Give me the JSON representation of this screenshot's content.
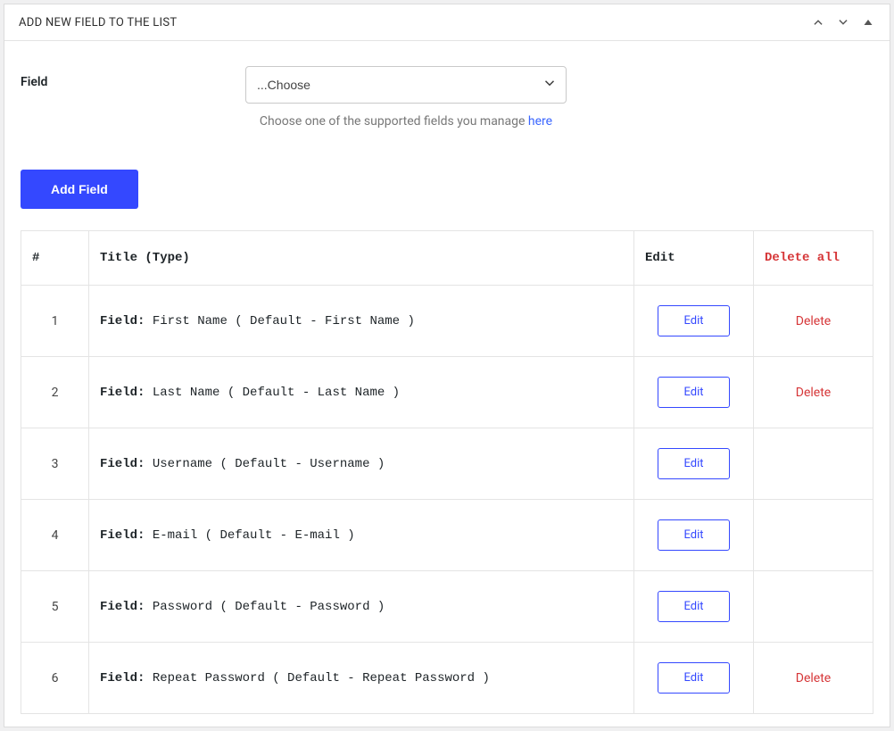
{
  "panel": {
    "title": "ADD NEW FIELD TO THE LIST"
  },
  "form": {
    "field_label": "Field",
    "select_placeholder": "...Choose",
    "help_prefix": "Choose one of the supported fields you manage ",
    "help_link": "here",
    "add_button": "Add Field"
  },
  "table": {
    "headers": {
      "num": "#",
      "title": "Title (Type)",
      "edit": "Edit",
      "delete_all": "Delete all"
    },
    "row_label_prefix": "Field:",
    "edit_label": "Edit",
    "delete_label": "Delete",
    "rows": [
      {
        "n": "1",
        "text": "First Name ( Default - First Name )",
        "deletable": true
      },
      {
        "n": "2",
        "text": "Last Name ( Default - Last Name )",
        "deletable": true
      },
      {
        "n": "3",
        "text": "Username ( Default - Username )",
        "deletable": false
      },
      {
        "n": "4",
        "text": "E-mail ( Default - E-mail )",
        "deletable": false
      },
      {
        "n": "5",
        "text": "Password ( Default - Password )",
        "deletable": false
      },
      {
        "n": "6",
        "text": "Repeat Password ( Default - Repeat Password )",
        "deletable": true
      }
    ]
  }
}
